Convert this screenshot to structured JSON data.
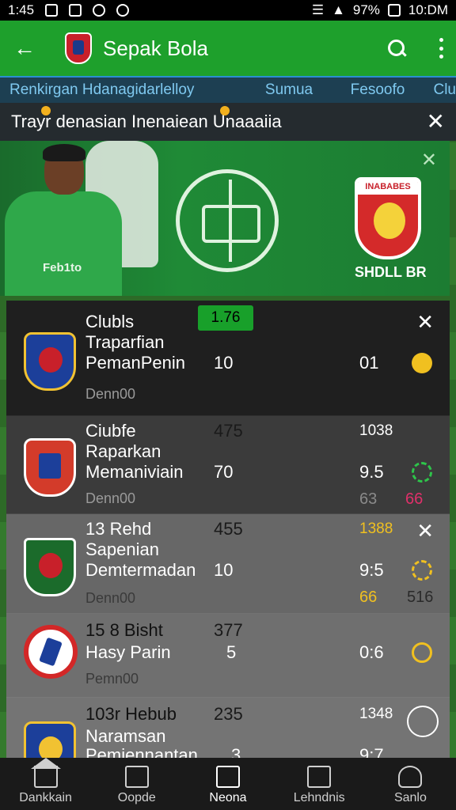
{
  "status_bar": {
    "time_left": "1:45",
    "battery": "97%",
    "time_right": "10:DM"
  },
  "app_bar": {
    "title": "Sepak Bola"
  },
  "tabs": [
    "Renkirgan Hdanagidarlelloy",
    "Sumua",
    "Fesoofo",
    "Clu"
  ],
  "notice": {
    "text": "Trayr denasian Inenaiean Unaaaiia"
  },
  "banner": {
    "shirt_text": "Feb1to",
    "crest_title": "INABABES",
    "caption": "SHDLL BR"
  },
  "rows": [
    {
      "name_lines": [
        "Clubls",
        "Traparfian",
        "PemanPenin"
      ],
      "value_left": "10",
      "value_right": "01",
      "sub": "Denn00",
      "badge": "1.76"
    },
    {
      "name_lines": [
        "Ciubfe",
        "Raparkan",
        "Memaniviain"
      ],
      "top_left": "475",
      "top_right": "1038",
      "value_left": "70",
      "value_right": "9.5",
      "sub": "Denn00",
      "bottom_mid": "63",
      "bottom_right": "66"
    },
    {
      "name_lines": [
        "13 Rehd",
        "Sapenian",
        "Demtermadan"
      ],
      "top_left": "455",
      "top_right": "1388",
      "value_left": "10",
      "value_right": "9:5",
      "sub": "Denn00",
      "bottom_mid": "66",
      "bottom_right": "516"
    },
    {
      "name_lines": [
        "15 8 Bisht",
        "Hasy Parin"
      ],
      "top_left": "377",
      "value_left": "5",
      "value_right": "0:6",
      "sub": "Pemn00"
    },
    {
      "name_lines": [
        "103r Hebub",
        "Naramsan",
        "Pemiennantan"
      ],
      "top_left": "235",
      "top_right": "1348",
      "value_left": "3",
      "value_right": "9:7"
    }
  ],
  "bottom_nav": [
    "Dankkain",
    "Oopde",
    "Neona",
    "Lehndnis",
    "Sanlo"
  ],
  "colors": {
    "app_bar": "#1ea02c",
    "accent_yellow": "#f0c020",
    "tab_text": "#7fc9f0"
  }
}
